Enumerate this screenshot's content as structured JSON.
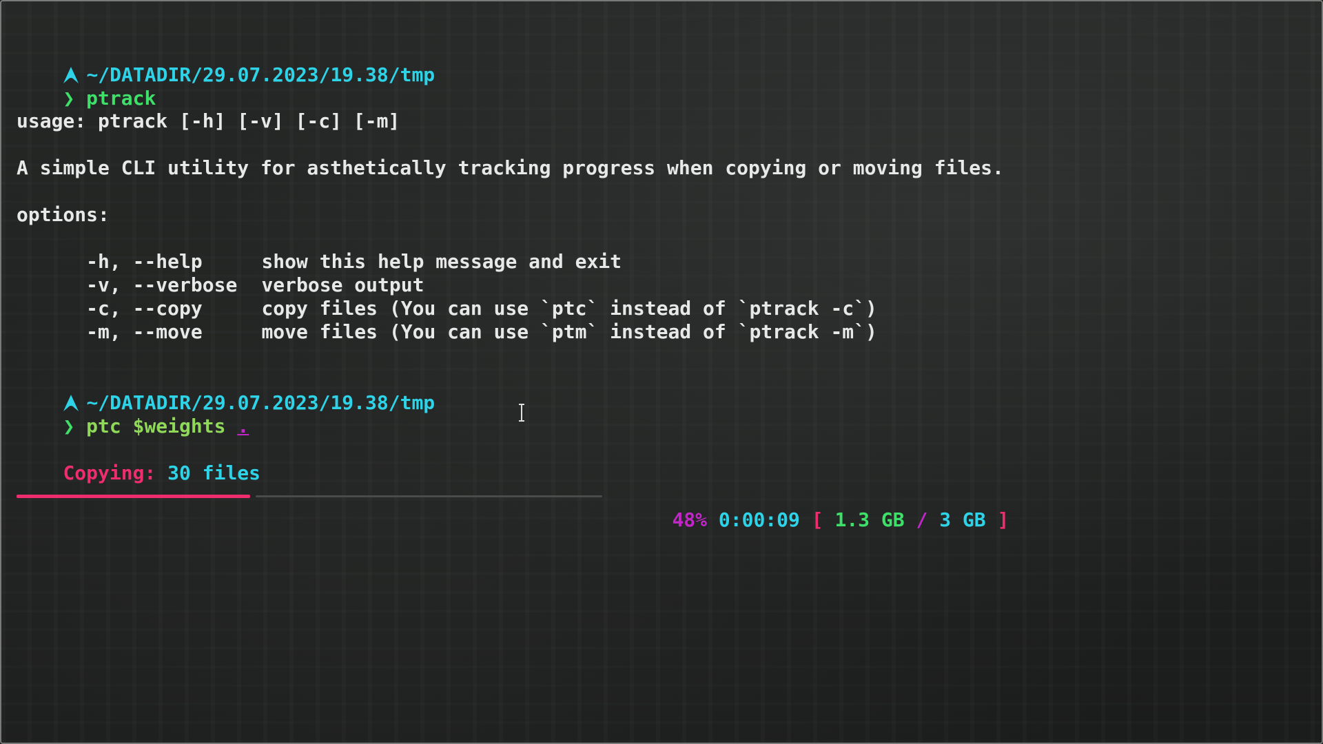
{
  "prompt1": {
    "path": "~/DATADIR/29.07.2023/19.38/tmp",
    "chevron": "❯",
    "command": "ptrack"
  },
  "help": {
    "usage": "usage: ptrack [-h] [-v] [-c] [-m]",
    "description": "A simple CLI utility for asthetically tracking progress when copying or moving files.",
    "options_header": "options:",
    "options": [
      {
        "flag": "  -h, --help",
        "desc": "show this help message and exit"
      },
      {
        "flag": "  -v, --verbose",
        "desc": "verbose output"
      },
      {
        "flag": "  -c, --copy",
        "desc": "copy files (You can use `ptc` instead of `ptrack -c`)"
      },
      {
        "flag": "  -m, --move",
        "desc": "move files (You can use `ptm` instead of `ptrack -m`)"
      }
    ]
  },
  "prompt2": {
    "path": "~/DATADIR/29.07.2023/19.38/tmp",
    "chevron": "❯",
    "command": "ptc",
    "variable": "$weights",
    "target": "."
  },
  "status": {
    "label": "Copying:",
    "files": "30 files"
  },
  "progress": {
    "fraction": 0.48,
    "percent": "48%",
    "elapsed": "0:00:09",
    "open_bracket": "[",
    "done": "1.3 GB",
    "slash": "/",
    "total": "3 GB",
    "close_bracket": "]"
  },
  "colors": {
    "accent_pink": "#ee2d6e",
    "accent_cyan": "#2fd3e8",
    "accent_green": "#3ee06a",
    "accent_magenta": "#c326c8"
  },
  "icons": {
    "distro_logo": "arch-linux-icon",
    "cursor": "text-cursor-icon"
  }
}
